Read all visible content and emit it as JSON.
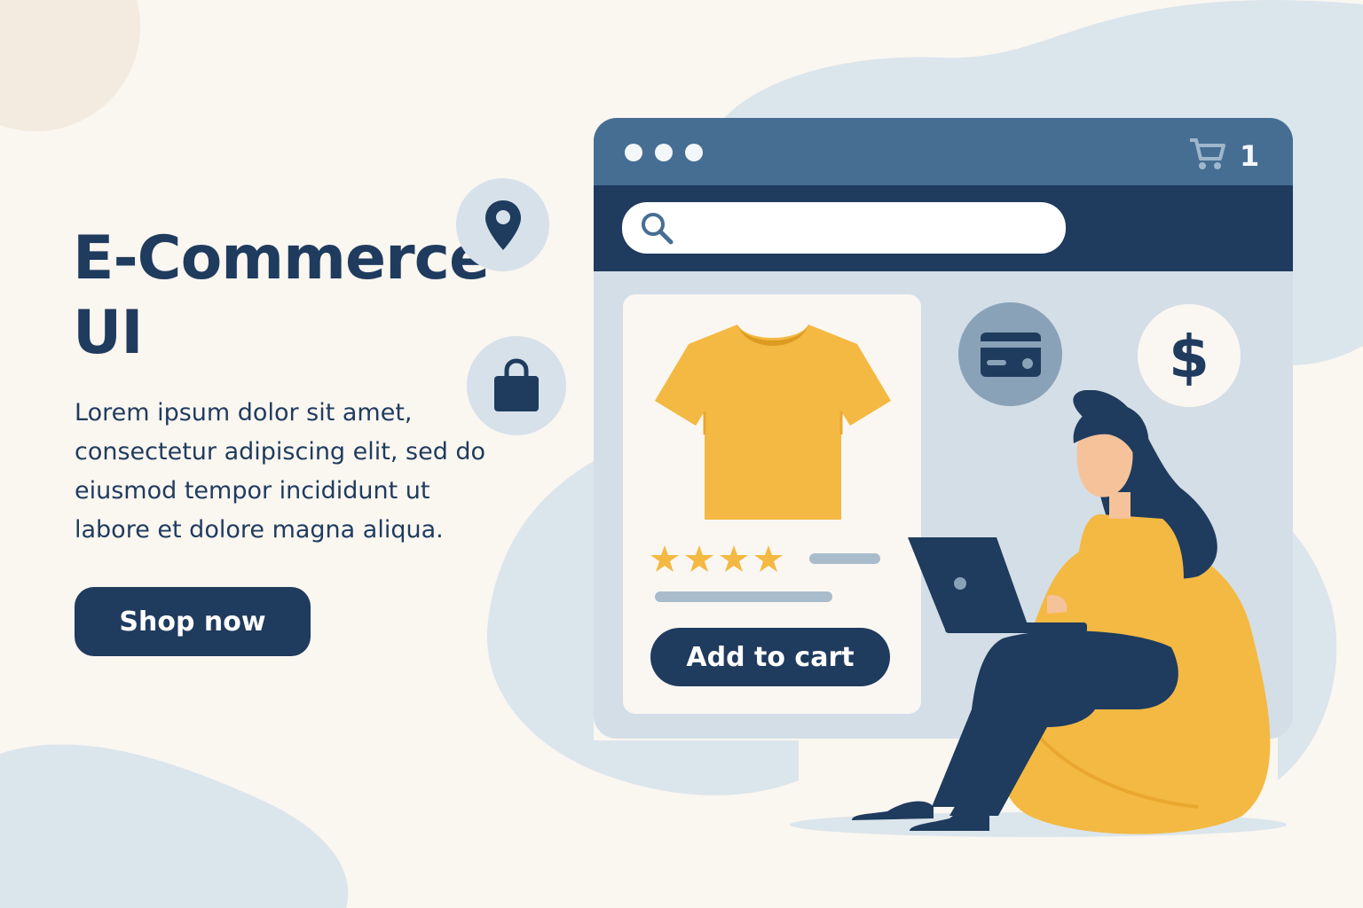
{
  "hero": {
    "title_line1": "E-Commerce",
    "title_line2": "UI",
    "body": "Lorem ipsum dolor sit amet, consectetur adipiscing elit, sed do eiusmod tempor incididunt ut labore et dolore magna aliqua.",
    "cta_label": "Shop now"
  },
  "browser": {
    "cart_count": "1",
    "search": {
      "value": "",
      "placeholder": ""
    }
  },
  "product": {
    "name_icon": "t-shirt-icon",
    "rating": 4,
    "rating_max": 4,
    "add_to_cart_label": "Add to cart"
  },
  "floating_icons": [
    "location-pin-icon",
    "shopping-bag-icon",
    "credit-card-icon",
    "dollar-icon"
  ],
  "colors": {
    "navy": "#1f3b5e",
    "steel_blue": "#466e93",
    "mustard": "#f4b942",
    "background": "#faf6f0",
    "light_blue": "#d3dee7"
  }
}
